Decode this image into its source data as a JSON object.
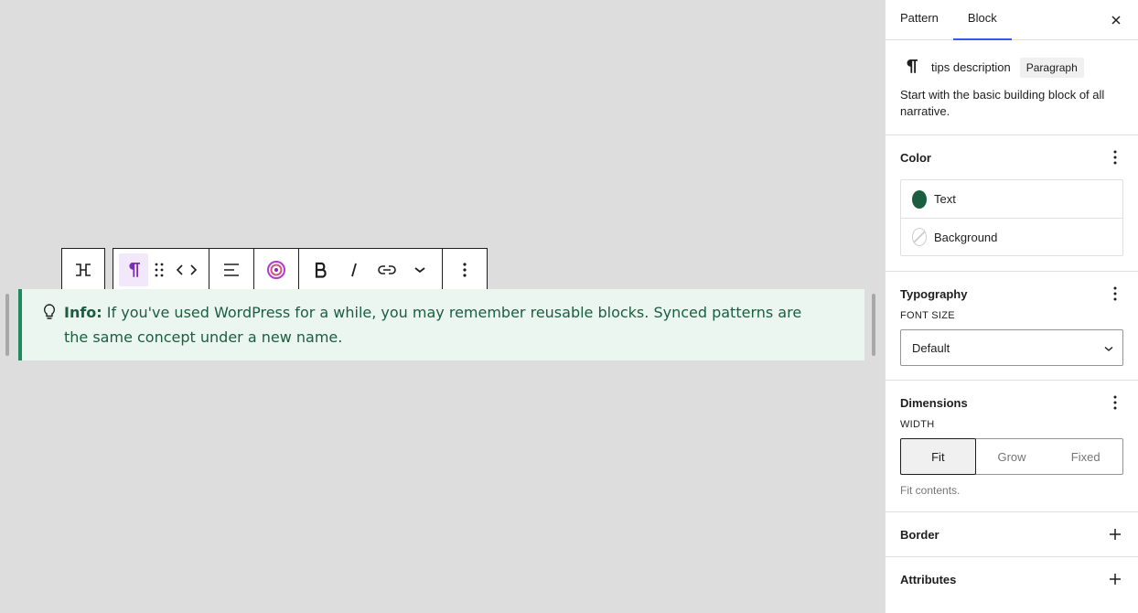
{
  "toolbar": {
    "icons": [
      "transform-icon",
      "paragraph-icon",
      "drag-handle-icon",
      "move-arrows-icon",
      "align-icon",
      "ai-icon",
      "bold-icon",
      "italic-icon",
      "link-icon",
      "more-chevron-icon",
      "options-icon"
    ]
  },
  "block": {
    "label": "Info:",
    "text": " If you've used WordPress for a while, you may remember reusable blocks. Synced patterns are the same concept under a new name.",
    "text_color": "#1b5e3f",
    "background_color": "#ecf6f0",
    "border_color": "#1f8a60"
  },
  "sidebar": {
    "tabs": [
      {
        "label": "Pattern"
      },
      {
        "label": "Block"
      }
    ],
    "card": {
      "title": "tips description",
      "badge": "Paragraph",
      "description": "Start with the basic building block of all narrative."
    },
    "color": {
      "title": "Color",
      "items": [
        {
          "label": "Text",
          "swatch": "#1b5e3f"
        },
        {
          "label": "Background",
          "swatch": "transparent"
        }
      ]
    },
    "typography": {
      "title": "Typography",
      "font_size_label": "FONT SIZE",
      "font_size_value": "Default"
    },
    "dimensions": {
      "title": "Dimensions",
      "width_label": "WIDTH",
      "options": [
        "Fit",
        "Grow",
        "Fixed"
      ],
      "selected": "Fit",
      "help": "Fit contents."
    },
    "border": {
      "title": "Border"
    },
    "attributes": {
      "title": "Attributes"
    }
  }
}
